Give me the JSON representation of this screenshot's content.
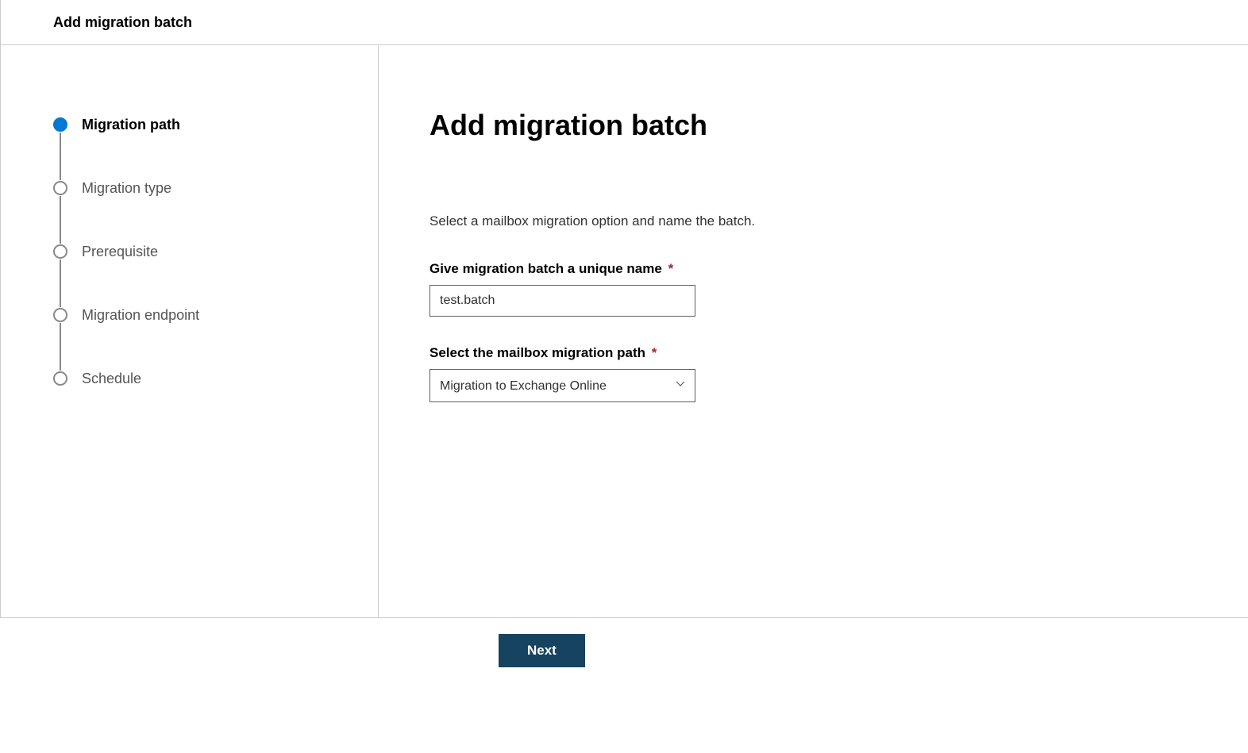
{
  "header": {
    "title": "Add migration batch"
  },
  "sidebar": {
    "steps": [
      {
        "label": "Migration path",
        "active": true
      },
      {
        "label": "Migration type",
        "active": false
      },
      {
        "label": "Prerequisite",
        "active": false
      },
      {
        "label": "Migration endpoint",
        "active": false
      },
      {
        "label": "Schedule",
        "active": false
      }
    ]
  },
  "main": {
    "title": "Add migration batch",
    "subtitle": "Select a mailbox migration option and name the batch.",
    "name_field": {
      "label": "Give migration batch a unique name",
      "required_mark": "*",
      "value": "test.batch"
    },
    "path_field": {
      "label": "Select the mailbox migration path",
      "required_mark": "*",
      "selected": "Migration to Exchange Online"
    }
  },
  "footer": {
    "next_label": "Next"
  }
}
